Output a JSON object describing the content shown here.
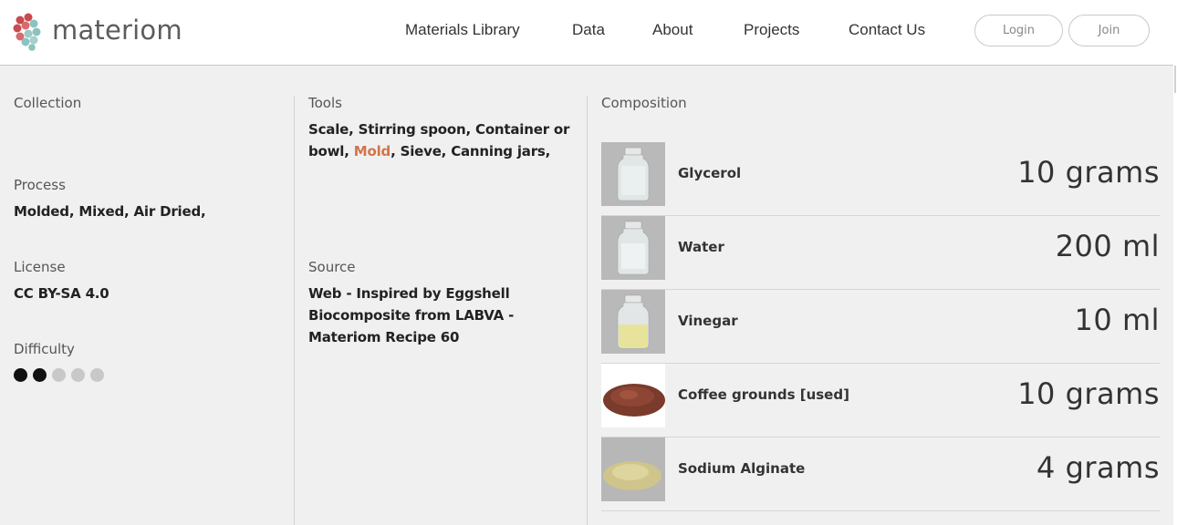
{
  "brand": {
    "name": "materiom"
  },
  "nav": {
    "items": [
      {
        "label": "Materials Library"
      },
      {
        "label": "Data"
      },
      {
        "label": "About"
      },
      {
        "label": "Projects"
      },
      {
        "label": "Contact Us"
      }
    ],
    "login_label": "Login",
    "join_label": "Join"
  },
  "details": {
    "collection_label": "Collection",
    "process_label": "Process",
    "process_value": "Molded, Mixed, Air Dried,",
    "license_label": "License",
    "license_value": "CC BY-SA 4.0",
    "difficulty_label": "Difficulty",
    "difficulty_level": 2,
    "difficulty_max": 5,
    "tools_label": "Tools",
    "tools_line1": "Scale, Stirring spoon, Container or",
    "tools_line2_prefix": "bowl, ",
    "tools_line2_link": "Mold",
    "tools_line2_suffix": ", Sieve, Canning jars,",
    "source_label": "Source",
    "source_line1": "Web - Inspired by Eggshell",
    "source_line2": "Biocomposite from LABVA -",
    "source_line3": "Materiom Recipe 60"
  },
  "composition": {
    "label": "Composition",
    "items": [
      {
        "name": "Glycerol",
        "qty": "10 grams",
        "image": "jar-clear-icon"
      },
      {
        "name": "Water",
        "qty": "200 ml",
        "image": "jar-clear-icon"
      },
      {
        "name": "Vinegar",
        "qty": "10 ml",
        "image": "jar-yellow-icon"
      },
      {
        "name": "Coffee grounds [used]",
        "qty": "10 grams",
        "image": "coffee-pile-icon"
      },
      {
        "name": "Sodium Alginate",
        "qty": "4 grams",
        "image": "powder-pile-icon"
      }
    ]
  },
  "colors": {
    "accent": "#d4734a",
    "logo_red": "#c94a4f",
    "logo_teal": "#8cc2c0"
  }
}
